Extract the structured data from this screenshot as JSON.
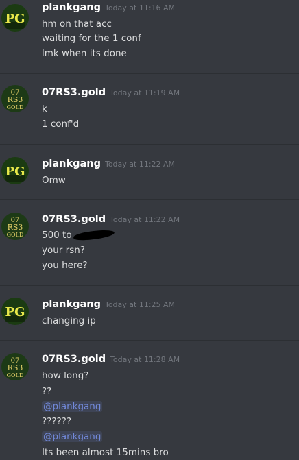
{
  "messages": [
    {
      "author": "plankgang",
      "timestamp": "Today at 11:16 AM",
      "avatar_text": "PG",
      "lines": [
        "hm on that acc",
        "waiting for the 1 conf",
        "lmk when its done"
      ]
    },
    {
      "author": "07RS3.gold",
      "timestamp": "Today at 11:19 AM",
      "avatar_text": "07 RS3 GOLD",
      "lines": [
        "k",
        "1 conf'd"
      ]
    },
    {
      "author": "plankgang",
      "timestamp": "Today at 11:22 AM",
      "avatar_text": "PG",
      "lines": [
        "Omw"
      ]
    },
    {
      "author": "07RS3.gold",
      "timestamp": "Today at 11:22 AM",
      "avatar_text": "07 RS3 GOLD",
      "lines": [
        "500 to",
        "your rsn?",
        "you here?"
      ]
    },
    {
      "author": "plankgang",
      "timestamp": "Today at 11:25 AM",
      "avatar_text": "PG",
      "lines": [
        "changing ip"
      ]
    },
    {
      "author": "07RS3.gold",
      "timestamp": "Today at 11:28 AM",
      "avatar_text": "07 RS3 GOLD",
      "lines": [
        "how long?",
        "??",
        "@plankgang",
        "??????",
        "@plankgang",
        "Its been almost 15mins bro"
      ]
    }
  ],
  "colors": {
    "background": "#36393f",
    "divider": "#2c2f33",
    "username": "#ffffff",
    "timestamp": "#72767d",
    "text": "#dcddde",
    "mention": "#7289da",
    "pg_avatar_bg": "#1b3b12",
    "pg_avatar_text": "#e8e84a",
    "gold_avatar_bg": "#1d3a16",
    "gold_avatar_text": "#e8d26a"
  }
}
